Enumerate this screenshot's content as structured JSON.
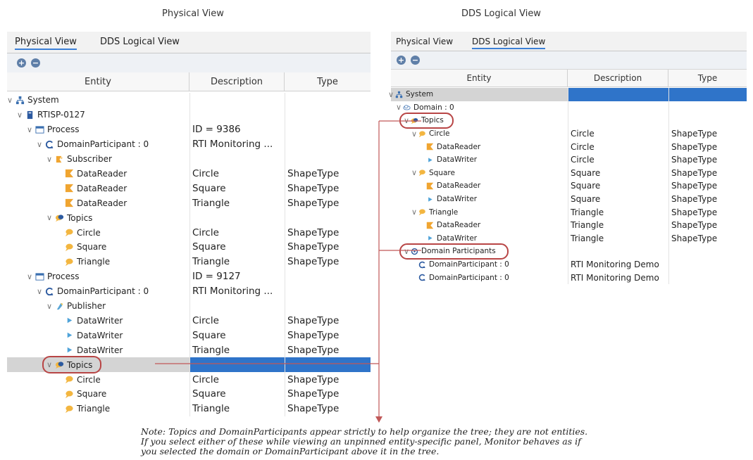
{
  "captions": {
    "left": "Physical View",
    "right": "DDS Logical View"
  },
  "left": {
    "tabs": [
      "Physical View",
      "DDS Logical View"
    ],
    "toolbar": {
      "expand": "+",
      "collapse": "−"
    },
    "columns": [
      "Entity",
      "Description",
      "Type"
    ],
    "rows": [
      {
        "label": "System",
        "desc": "",
        "type": "",
        "depth": 0,
        "expander": true,
        "icon": "system"
      },
      {
        "label": "RTISP-0127",
        "desc": "",
        "type": "",
        "depth": 1,
        "expander": true,
        "icon": "host"
      },
      {
        "label": "Process",
        "desc": "ID = 9386",
        "type": "",
        "depth": 2,
        "expander": true,
        "icon": "process"
      },
      {
        "label": "DomainParticipant : 0",
        "desc": "RTI Monitoring ...",
        "type": "",
        "depth": 3,
        "expander": true,
        "icon": "participant"
      },
      {
        "label": "Subscriber",
        "desc": "",
        "type": "",
        "depth": 4,
        "expander": true,
        "icon": "subscriber"
      },
      {
        "label": "DataReader",
        "desc": "Circle",
        "type": "ShapeType",
        "depth": 5,
        "expander": false,
        "icon": "reader"
      },
      {
        "label": "DataReader",
        "desc": "Square",
        "type": "ShapeType",
        "depth": 5,
        "expander": false,
        "icon": "reader"
      },
      {
        "label": "DataReader",
        "desc": "Triangle",
        "type": "ShapeType",
        "depth": 5,
        "expander": false,
        "icon": "reader"
      },
      {
        "label": "Topics",
        "desc": "",
        "type": "",
        "depth": 4,
        "expander": true,
        "icon": "topics"
      },
      {
        "label": "Circle",
        "desc": "Circle",
        "type": "ShapeType",
        "depth": 5,
        "expander": false,
        "icon": "topic"
      },
      {
        "label": "Square",
        "desc": "Square",
        "type": "ShapeType",
        "depth": 5,
        "expander": false,
        "icon": "topic"
      },
      {
        "label": "Triangle",
        "desc": "Triangle",
        "type": "ShapeType",
        "depth": 5,
        "expander": false,
        "icon": "topic"
      },
      {
        "label": "Process",
        "desc": "ID = 9127",
        "type": "",
        "depth": 2,
        "expander": true,
        "icon": "process"
      },
      {
        "label": "DomainParticipant : 0",
        "desc": "RTI Monitoring ...",
        "type": "",
        "depth": 3,
        "expander": true,
        "icon": "participant"
      },
      {
        "label": "Publisher",
        "desc": "",
        "type": "",
        "depth": 4,
        "expander": true,
        "icon": "publisher"
      },
      {
        "label": "DataWriter",
        "desc": "Circle",
        "type": "ShapeType",
        "depth": 5,
        "expander": false,
        "icon": "writer"
      },
      {
        "label": "DataWriter",
        "desc": "Square",
        "type": "ShapeType",
        "depth": 5,
        "expander": false,
        "icon": "writer"
      },
      {
        "label": "DataWriter",
        "desc": "Triangle",
        "type": "ShapeType",
        "depth": 5,
        "expander": false,
        "icon": "writer"
      },
      {
        "label": "Topics",
        "desc": "",
        "type": "",
        "depth": 4,
        "expander": true,
        "icon": "topics",
        "selected": true,
        "circled": true
      },
      {
        "label": "Circle",
        "desc": "Circle",
        "type": "ShapeType",
        "depth": 5,
        "expander": false,
        "icon": "topic"
      },
      {
        "label": "Square",
        "desc": "Square",
        "type": "ShapeType",
        "depth": 5,
        "expander": false,
        "icon": "topic"
      },
      {
        "label": "Triangle",
        "desc": "Triangle",
        "type": "ShapeType",
        "depth": 5,
        "expander": false,
        "icon": "topic"
      }
    ]
  },
  "right": {
    "tabs": [
      "Physical View",
      "DDS Logical View"
    ],
    "toolbar": {
      "expand": "+",
      "collapse": "−"
    },
    "columns": [
      "Entity",
      "Description",
      "Type"
    ],
    "rows": [
      {
        "label": "System",
        "desc": "",
        "type": "",
        "depth": 0,
        "expander": true,
        "icon": "system",
        "selected": true
      },
      {
        "label": "Domain : 0",
        "desc": "",
        "type": "",
        "depth": 1,
        "expander": true,
        "icon": "domain"
      },
      {
        "label": "Topics",
        "desc": "",
        "type": "",
        "depth": 2,
        "expander": true,
        "icon": "topics",
        "circled": true
      },
      {
        "label": "Circle",
        "desc": "Circle",
        "type": "ShapeType",
        "depth": 3,
        "expander": true,
        "icon": "topic"
      },
      {
        "label": "DataReader",
        "desc": "Circle",
        "type": "ShapeType",
        "depth": 4,
        "expander": false,
        "icon": "reader"
      },
      {
        "label": "DataWriter",
        "desc": "Circle",
        "type": "ShapeType",
        "depth": 4,
        "expander": false,
        "icon": "writer"
      },
      {
        "label": "Square",
        "desc": "Square",
        "type": "ShapeType",
        "depth": 3,
        "expander": true,
        "icon": "topic"
      },
      {
        "label": "DataReader",
        "desc": "Square",
        "type": "ShapeType",
        "depth": 4,
        "expander": false,
        "icon": "reader"
      },
      {
        "label": "DataWriter",
        "desc": "Square",
        "type": "ShapeType",
        "depth": 4,
        "expander": false,
        "icon": "writer"
      },
      {
        "label": "Triangle",
        "desc": "Triangle",
        "type": "ShapeType",
        "depth": 3,
        "expander": true,
        "icon": "topic"
      },
      {
        "label": "DataReader",
        "desc": "Triangle",
        "type": "ShapeType",
        "depth": 4,
        "expander": false,
        "icon": "reader"
      },
      {
        "label": "DataWriter",
        "desc": "Triangle",
        "type": "ShapeType",
        "depth": 4,
        "expander": false,
        "icon": "writer"
      },
      {
        "label": "Domain Participants",
        "desc": "",
        "type": "",
        "depth": 2,
        "expander": true,
        "icon": "participants",
        "circled": true
      },
      {
        "label": "DomainParticipant : 0",
        "desc": "RTI Monitoring Demo",
        "type": "",
        "depth": 3,
        "expander": false,
        "icon": "participant"
      },
      {
        "label": "DomainParticipant : 0",
        "desc": "RTI Monitoring Demo",
        "type": "",
        "depth": 3,
        "expander": false,
        "icon": "participant"
      }
    ]
  },
  "note": [
    "Note: Topics and DomainParticipants appear strictly to help organize the tree; they are not entities.",
    "If you select either of these while viewing an unpinned entity-specific panel, Monitor behaves as if",
    "you selected the domain or DomainParticipant above it in the tree."
  ],
  "colors": {
    "selection": "#2f74c9",
    "highlight_oval": "#b84545",
    "connector": "#c05858"
  }
}
